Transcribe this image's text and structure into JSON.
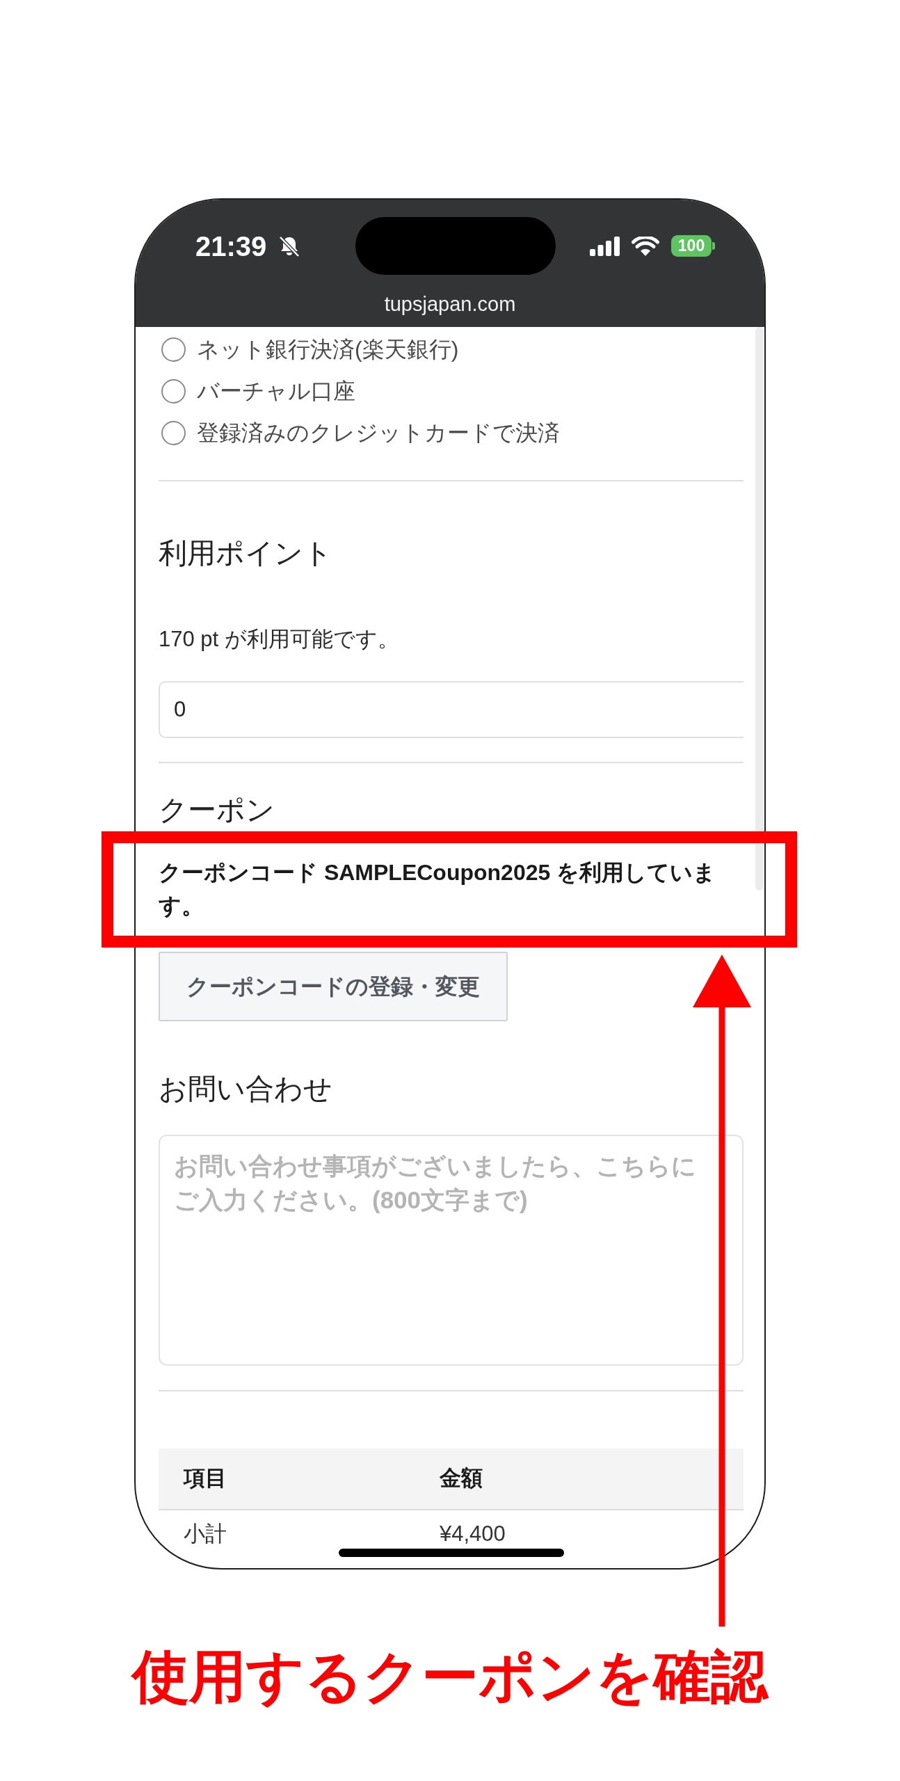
{
  "status_bar": {
    "time": "21:39",
    "battery": "100"
  },
  "browser": {
    "url": "tupsjapan.com"
  },
  "payment_methods": [
    {
      "label": "ネット銀行決済(楽天銀行)",
      "selected": false
    },
    {
      "label": "バーチャル口座",
      "selected": false
    },
    {
      "label": "登録済みのクレジットカードで決済",
      "selected": false
    }
  ],
  "points": {
    "title": "利用ポイント",
    "available": "170 pt が利用可能です。",
    "value": "0"
  },
  "coupon": {
    "title": "クーポン",
    "status": "クーポンコード SAMPLECoupon2025 を利用しています。",
    "button": "クーポンコードの登録・変更"
  },
  "inquiry": {
    "title": "お問い合わせ",
    "placeholder": "お問い合わせ事項がございましたら、こちらにご入力ください。(800文字まで)"
  },
  "summary_table": {
    "columns": [
      "項目",
      "金額"
    ],
    "rows": [
      [
        "小計",
        "¥4,400"
      ]
    ]
  },
  "annotation": {
    "caption": "使用するクーポンを確認"
  }
}
